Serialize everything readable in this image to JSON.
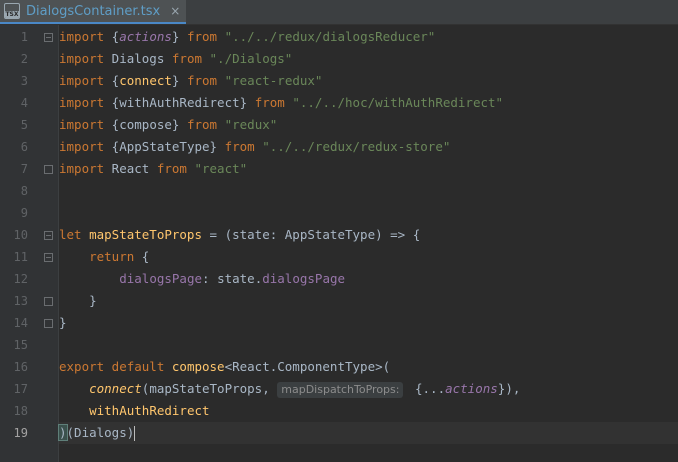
{
  "tab": {
    "icon_label": "TSX",
    "filename": "DialogsContainer.tsx",
    "close": "×"
  },
  "gutter": {
    "line_numbers": [
      "1",
      "2",
      "3",
      "4",
      "5",
      "6",
      "7",
      "8",
      "9",
      "10",
      "11",
      "12",
      "13",
      "14",
      "15",
      "16",
      "17",
      "18",
      "19"
    ],
    "current_line": "19"
  },
  "code": {
    "l1": {
      "kw": "import",
      "open": " {",
      "name": "actions",
      "close": "} ",
      "from": "from",
      "path": "\"../../redux/dialogsReducer\""
    },
    "l2": {
      "kw": "import",
      "name": " Dialogs ",
      "from": "from",
      "path": "\"./Dialogs\""
    },
    "l3": {
      "kw": "import",
      "open": " {",
      "name": "connect",
      "close": "} ",
      "from": "from",
      "path": "\"react-redux\""
    },
    "l4": {
      "kw": "import",
      "open": " {",
      "name": "withAuthRedirect",
      "close": "} ",
      "from": "from",
      "path": "\"../../hoc/withAuthRedirect\""
    },
    "l5": {
      "kw": "import",
      "open": " {",
      "name": "compose",
      "close": "} ",
      "from": "from",
      "path": "\"redux\""
    },
    "l6": {
      "kw": "import",
      "open": " {",
      "name": "AppStateType",
      "close": "} ",
      "from": "from",
      "path": "\"../../redux/redux-store\""
    },
    "l7": {
      "kw": "import",
      "name": " React ",
      "from": "from",
      "path": "\"react\""
    },
    "l10": {
      "kw": "let",
      "name": " mapStateToProps",
      "rest": " = (state: AppStateType) => {"
    },
    "l11": {
      "indent": "    ",
      "kw": "return",
      "rest": " {"
    },
    "l12": {
      "indent": "        ",
      "prop": "dialogsPage",
      "mid": ": state.",
      "prop2": "dialogsPage"
    },
    "l13": {
      "indent": "    ",
      "rest": "}"
    },
    "l14": {
      "rest": "}"
    },
    "l16": {
      "kw": "export default",
      "sp": " ",
      "fn": "compose",
      "rest": "<React.ComponentType>("
    },
    "l17": {
      "indent": "    ",
      "fn": "connect",
      "a": "(mapStateToProps, ",
      "hint": "mapDispatchToProps:",
      "b": " {...",
      "name": "actions",
      "c": "}),"
    },
    "l18": {
      "indent": "    ",
      "fn": "withAuthRedirect"
    },
    "l19": {
      "a": ")",
      "b": "(Dialogs)"
    }
  },
  "colors": {
    "background": "#2b2b2b",
    "keyword": "#cc7832",
    "string": "#6a8759",
    "function": "#ffc66d",
    "property": "#9876aa",
    "tab_text": "#5f9ec7"
  }
}
